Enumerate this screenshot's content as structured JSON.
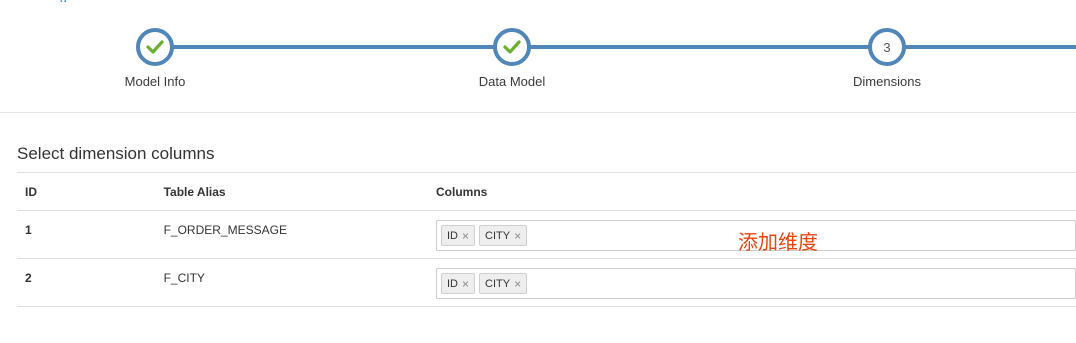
{
  "header": {
    "cutoff_link": "g"
  },
  "wizard": {
    "steps": [
      {
        "label": "Model Info",
        "state": "done",
        "icon": "check-icon"
      },
      {
        "label": "Data Model",
        "state": "done",
        "icon": "check-icon"
      },
      {
        "label": "Dimensions",
        "state": "current",
        "number": "3"
      }
    ]
  },
  "section": {
    "title": "Select dimension columns"
  },
  "table": {
    "headers": [
      "ID",
      "Table Alias",
      "Columns"
    ],
    "rows": [
      {
        "id": "1",
        "alias": "F_ORDER_MESSAGE",
        "columns": [
          "ID",
          "CITY"
        ]
      },
      {
        "id": "2",
        "alias": "F_CITY",
        "columns": [
          "ID",
          "CITY"
        ]
      }
    ],
    "tag_remove_symbol": "×"
  },
  "annotation": {
    "text": "添加维度",
    "color": "#e8440f"
  },
  "colors": {
    "accent": "#5086b8",
    "check": "#6ab02e"
  }
}
